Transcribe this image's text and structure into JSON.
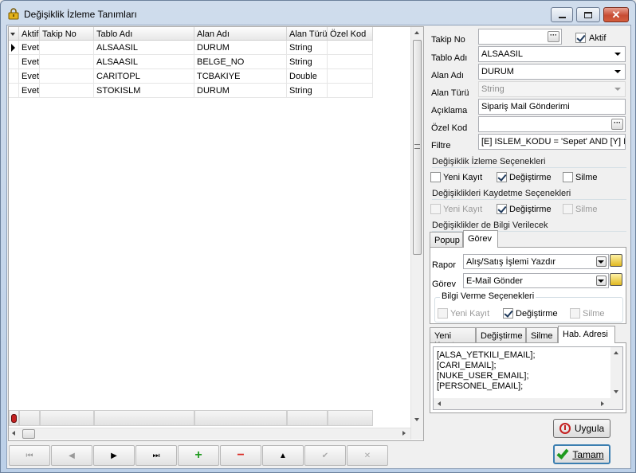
{
  "window": {
    "title": "Değişiklik İzleme Tanımları"
  },
  "grid": {
    "headers": [
      "Aktif",
      "Takip No",
      "Tablo Adı",
      "Alan Adı",
      "Alan Türü",
      "Özel Kod"
    ],
    "rows": [
      {
        "aktif": "Evet",
        "takip": "",
        "tablo": "ALSAASIL",
        "alan": "DURUM",
        "tur": "String",
        "kod": ""
      },
      {
        "aktif": "Evet",
        "takip": "",
        "tablo": "ALSAASIL",
        "alan": "BELGE_NO",
        "tur": "String",
        "kod": ""
      },
      {
        "aktif": "Evet",
        "takip": "",
        "tablo": "CARITOPL",
        "alan": "TCBAKIYE",
        "tur": "Double",
        "kod": ""
      },
      {
        "aktif": "Evet",
        "takip": "",
        "tablo": "STOKISLM",
        "alan": "DURUM",
        "tur": "String",
        "kod": ""
      }
    ]
  },
  "nav": {
    "first": "⏮",
    "prev": "◀",
    "next": "▶",
    "last": "⏭",
    "add": "+",
    "delete": "−",
    "up": "▲",
    "confirm": "✔",
    "cancel": "✕"
  },
  "form": {
    "takip_no_label": "Takip No",
    "takip_no_value": "",
    "aktif_label": "Aktif",
    "aktif_checked": true,
    "tablo_adi_label": "Tablo Adı",
    "tablo_adi_value": "ALSAASIL",
    "alan_adi_label": "Alan Adı",
    "alan_adi_value": "DURUM",
    "alan_turu_label": "Alan Türü",
    "alan_turu_value": "String",
    "aciklama_label": "Açıklama",
    "aciklama_value": "Sipariş Mail Gönderimi",
    "ozel_kod_label": "Özel Kod",
    "ozel_kod_value": "",
    "filtre_label": "Filtre",
    "filtre_value": "[E] ISLEM_KODU = 'Sepet' AND [Y] IS"
  },
  "izleme": {
    "title": "Değişiklik İzleme Seçenekleri",
    "yeni": "Yeni Kayıt",
    "degistirme": "Değiştirme",
    "silme": "Silme"
  },
  "kaydetme": {
    "title": "Değişiklikleri Kaydetme Seçenekleri",
    "yeni": "Yeni Kayıt",
    "degistirme": "Değiştirme",
    "silme": "Silme"
  },
  "bilgi": {
    "title": "Değişiklikler de Bilgi Verilecek",
    "tabs": [
      "Popup",
      "Görev"
    ],
    "rapor_label": "Rapor",
    "rapor_value": "Alış/Satış İşlemi Yazdır",
    "gorev_label": "Görev",
    "gorev_value": "E-Mail Gönder",
    "secenek_title": "Bilgi Verme Seçenekleri",
    "yeni": "Yeni Kayıt",
    "degistirme": "Değiştirme",
    "silme": "Silme",
    "subtabs": [
      "Yeni Kayıt",
      "Değiştirme",
      "Silme",
      "Hab. Adresi"
    ],
    "addresses": [
      "[ALSA_YETKILI_EMAIL];",
      "[CARI_EMAIL];",
      "[NUKE_USER_EMAIL];",
      "[PERSONEL_EMAIL];"
    ]
  },
  "buttons": {
    "uygula": "Uygula",
    "tamam": "Tamam"
  },
  "colors": {
    "green": "#1f9a1f",
    "red": "#d9251d",
    "accent": "#3c7fb1"
  }
}
